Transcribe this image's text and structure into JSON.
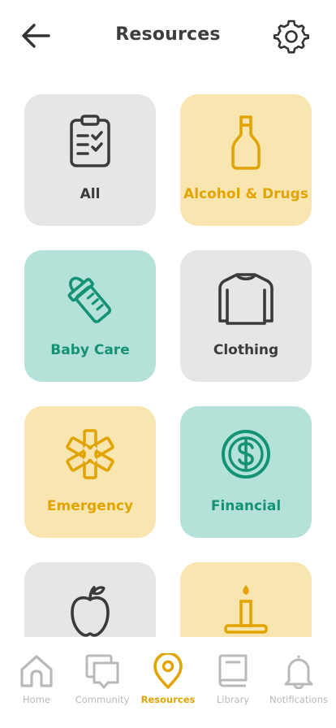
{
  "header": {
    "title": "Resources",
    "back_icon": "arrow-left-icon",
    "settings_icon": "gear-icon"
  },
  "colors": {
    "gray_tile": "#e6e6e6",
    "yellow_tile": "#f8e5b0",
    "teal_tile": "#b5e2d8",
    "yellow_accent": "#e2a400",
    "teal_accent": "#149274",
    "dark_text": "#3a3a3a",
    "inactive_tab": "#b9b9b9"
  },
  "categories": [
    {
      "label": "All",
      "icon": "clipboard-checklist-icon",
      "theme": "gray"
    },
    {
      "label": "Alcohol & Drugs",
      "icon": "bottle-icon",
      "theme": "yellow"
    },
    {
      "label": "Baby Care",
      "icon": "baby-bottle-icon",
      "theme": "teal"
    },
    {
      "label": "Clothing",
      "icon": "sweater-icon",
      "theme": "gray"
    },
    {
      "label": "Emergency",
      "icon": "medical-star-icon",
      "theme": "yellow"
    },
    {
      "label": "Financial",
      "icon": "dollar-circle-icon",
      "theme": "teal"
    },
    {
      "label": "",
      "icon": "apple-icon",
      "theme": "gray"
    },
    {
      "label": "",
      "icon": "candle-icon",
      "theme": "yellow"
    }
  ],
  "tabs": [
    {
      "label": "Home",
      "icon": "home-icon",
      "active": false
    },
    {
      "label": "Community",
      "icon": "chat-bubbles-icon",
      "active": false
    },
    {
      "label": "Resources",
      "icon": "map-pin-icon",
      "active": true
    },
    {
      "label": "Library",
      "icon": "book-icon",
      "active": false
    },
    {
      "label": "Notifications",
      "icon": "bell-icon",
      "active": false
    }
  ]
}
